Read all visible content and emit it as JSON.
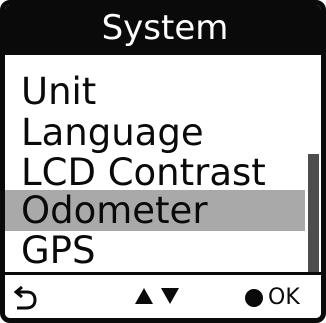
{
  "screen": {
    "title": "System"
  },
  "menu": {
    "items": [
      {
        "label": "Unit"
      },
      {
        "label": "Language"
      },
      {
        "label": "LCD Contrast"
      },
      {
        "label": "Odometer"
      },
      {
        "label": "GPS"
      }
    ],
    "selected_index": 3
  },
  "scrollbar": {
    "position_fraction": 0.43,
    "visible_fraction": 0.57
  },
  "footer": {
    "back_icon": "back-arrow-icon",
    "nav_icons": [
      "up-triangle-icon",
      "down-triangle-icon"
    ],
    "ok_icon": "filled-circle-icon",
    "ok_label": "OK"
  },
  "colors": {
    "title_bg": "#0a0a0a",
    "title_text": "#ffffff",
    "highlight": "#a9a9a9",
    "scroll_thumb": "#4d4d4d"
  }
}
